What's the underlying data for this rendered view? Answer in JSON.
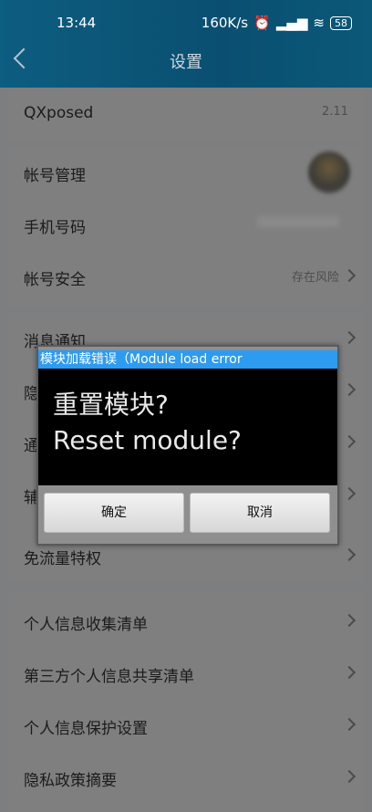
{
  "status": {
    "time": "13:44",
    "speed": "160K/s",
    "battery": "58"
  },
  "header": {
    "title": "设置"
  },
  "rows": {
    "qxposed": {
      "label": "QXposed",
      "value": "2.11"
    },
    "account_manage": {
      "label": "帐号管理"
    },
    "phone": {
      "label": "手机号码"
    },
    "account_security": {
      "label": "帐号安全",
      "value": "存在风险"
    },
    "message_notify": {
      "label": "消息通知"
    },
    "privacy": {
      "label": "隐"
    },
    "general": {
      "label": "通"
    },
    "assist": {
      "label": "辅"
    },
    "free_traffic": {
      "label": "免流量特权"
    },
    "personal_info_list": {
      "label": "个人信息收集清单"
    },
    "third_party_list": {
      "label": "第三方个人信息共享清单"
    },
    "personal_info_protect": {
      "label": "个人信息保护设置"
    },
    "privacy_summary": {
      "label": "隐私政策摘要"
    }
  },
  "dialog": {
    "title": "模块加载错误（Module load error",
    "line1": "重置模块?",
    "line2": "Reset module?",
    "ok_label": "确定",
    "cancel_label": "取消"
  },
  "colors": {
    "header_bg": "#0a4f71",
    "dialog_title_bg": "#2d9bf0",
    "dialog_body_bg": "#000000"
  }
}
